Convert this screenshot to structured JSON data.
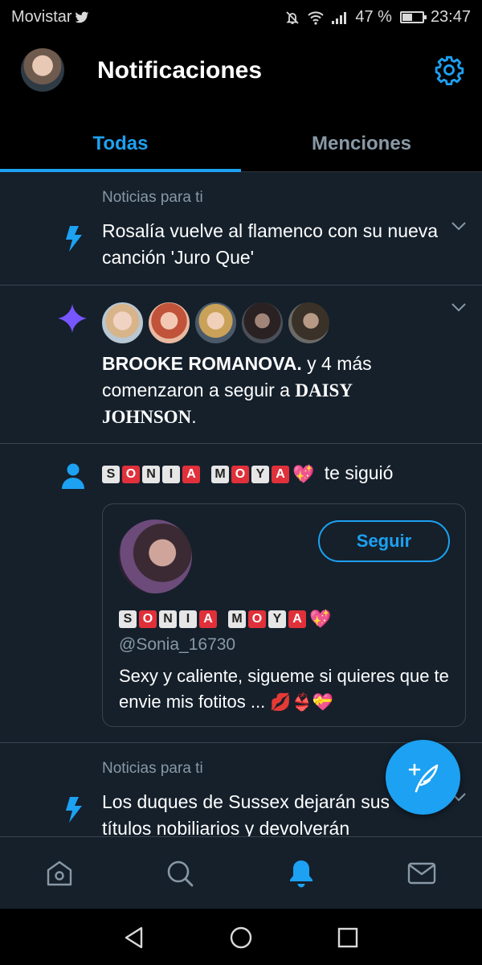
{
  "status_bar": {
    "carrier": "Movistar",
    "battery": "47 %",
    "battery_level": 0.47,
    "time": "23:47"
  },
  "header": {
    "title": "Notificaciones"
  },
  "tabs": [
    {
      "label": "Todas",
      "active": true
    },
    {
      "label": "Menciones",
      "active": false
    }
  ],
  "feed": {
    "news1": {
      "kicker": "Noticias para ti",
      "text": "Rosalía vuelve al flamenco con su nueva canción 'Juro Que'"
    },
    "follow_group": {
      "name": "BROOKE ROMANOVA.",
      "middle": " y 4 más comenzaron a seguir a ",
      "target": "DAISY JOHNSON",
      "end": "."
    },
    "single_follow": {
      "name_part1": [
        "S",
        "O",
        "N",
        "I",
        "A"
      ],
      "name_part2": [
        "M",
        "O",
        "Y",
        "A"
      ],
      "action": "te siguió"
    },
    "card": {
      "follow_button": "Seguir",
      "handle": "@Sonia_16730",
      "bio": "Sexy y caliente, sigueme si quieres que te envie mis fotitos ..."
    },
    "news2": {
      "kicker": "Noticias para ti",
      "text": "Los duques de Sussex dejarán sus títulos nobiliarios y devolverán"
    }
  },
  "colors": {
    "accent": "#1da1f2",
    "background": "#15202b",
    "muted": "#8899a6",
    "star": "#7856ff",
    "tile_red": "#e0303a"
  }
}
